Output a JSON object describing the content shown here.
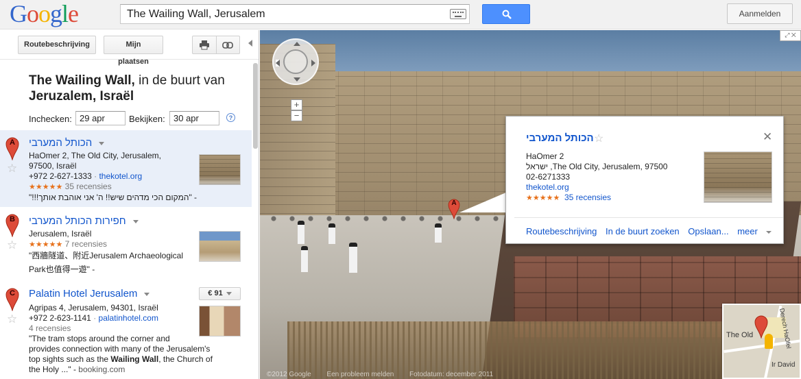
{
  "logo": {
    "text": "Google",
    "letters": [
      "G",
      "o",
      "o",
      "g",
      "l",
      "e"
    ],
    "colors": [
      "#3366cc",
      "#dd4b39",
      "#f4b400",
      "#3366cc",
      "#0f9d58",
      "#dd4b39"
    ]
  },
  "search": {
    "value": "The Wailing Wall, Jerusalem",
    "button_icon": "search-icon"
  },
  "signin": {
    "label": "Aanmelden"
  },
  "toolbar": {
    "route_label": "Routebeschrijving",
    "places_label": "Mijn plaatsen",
    "print_icon": "print-icon",
    "link_icon": "link-icon"
  },
  "heading": {
    "bold_1": "The Wailing Wall,",
    "middle": " in de buurt van ",
    "bold_2": "Jeruzalem, Israël"
  },
  "dates": {
    "checkin_label": "Inchecken:",
    "checkin_value": "29 apr",
    "view_label": "Bekijken:",
    "view_value": "30 apr",
    "help": "?"
  },
  "results": [
    {
      "letter": "A",
      "title": "הכותל המערבי",
      "address_1": "HaOmer 2, The Old City, Jerusalem,",
      "address_2": "97500, Israël",
      "phone": "+972 2-627-1333",
      "site": "thekotel.org",
      "stars": "★★★★★",
      "reviews": "35 recensies",
      "snippet": "\"!!!המקום הכי מדהים שיש!! ה' אני אוהבת אותך\" -"
    },
    {
      "letter": "B",
      "title": "חפירות הכותל המערבי",
      "address_1": "Jerusalem, Israël",
      "stars": "★★★★★",
      "reviews": "7 recensies",
      "snippet_1": "\"西牆隧道、附近Jerusalem Archaeological",
      "snippet_2": "Park也值得一遊\" -"
    },
    {
      "letter": "C",
      "title": "Palatin Hotel Jerusalem",
      "price": "€ 91",
      "address_1": "Agripas 4, Jerusalem, 94301, Israël",
      "phone": "+972 2-623-1141",
      "site": "palatinhotel.com",
      "reviews": "4 recensies",
      "snippet_1": "\"The tram stops around the corner and",
      "snippet_2": "provides connection with many of the Jerusalem's",
      "snippet_3a": "top sights such as the ",
      "snippet_3b": "Wailing Wall",
      "snippet_3c": ", the Church of",
      "snippet_4": "the Holy ...\" - ",
      "snippet_src": "booking.com"
    }
  ],
  "info_window": {
    "title": "הכותל המערבי",
    "line_1": "HaOmer 2",
    "line_2": "ישראל ,The Old City, Jerusalem, 97500",
    "line_3": "02-6271333",
    "site": "thekotel.org",
    "stars": "★★★★★",
    "reviews": "35 recensies",
    "actions": [
      "Routebeschrijving",
      "In de buurt zoeken",
      "Opslaan...",
      "meer"
    ]
  },
  "map": {
    "marker_letter": "A",
    "zoom_in": "+",
    "zoom_out": "−",
    "minimap_label_1": "The Old",
    "minimap_label_2": "Ir David",
    "minimap_label_3": "Derech HaOfel",
    "footer": [
      "©2012 Google",
      "Een probleem melden",
      "Fotodatum: december 2011"
    ]
  },
  "colors": {
    "link": "#1155cc",
    "star": "#e7711b",
    "marker": "#dd4b39",
    "search_button": "#4d90fe"
  }
}
